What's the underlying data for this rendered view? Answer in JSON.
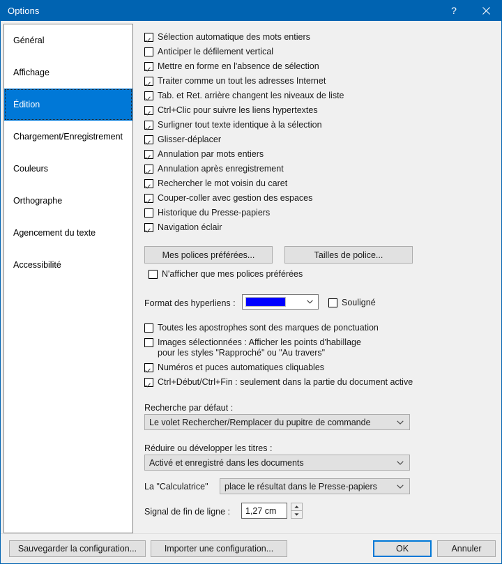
{
  "window": {
    "title": "Options",
    "help_icon": "question-mark-icon",
    "close_icon": "close-icon"
  },
  "sidebar": {
    "items": [
      {
        "label": "Général",
        "selected": false
      },
      {
        "label": "Affichage",
        "selected": false
      },
      {
        "label": "Édition",
        "selected": true
      },
      {
        "label": "Chargement/Enregistrement",
        "selected": false
      },
      {
        "label": "Couleurs",
        "selected": false
      },
      {
        "label": "Orthographe",
        "selected": false
      },
      {
        "label": "Agencement du texte",
        "selected": false
      },
      {
        "label": "Accessibilité",
        "selected": false
      }
    ],
    "selected_bg": "#0078d7"
  },
  "main": {
    "checkboxes_top": [
      {
        "label": "Sélection automatique des mots entiers",
        "checked": true
      },
      {
        "label": "Anticiper le défilement vertical",
        "checked": false
      },
      {
        "label": "Mettre en forme en l'absence de sélection",
        "checked": true
      },
      {
        "label": "Traiter comme un tout les adresses Internet",
        "checked": true
      },
      {
        "label": "Tab. et Ret. arrière changent les niveaux de liste",
        "checked": true
      },
      {
        "label": "Ctrl+Clic pour suivre les liens hypertextes",
        "checked": true
      },
      {
        "label": "Surligner tout texte identique à la sélection",
        "checked": true
      },
      {
        "label": "Glisser-déplacer",
        "checked": true
      },
      {
        "label": "Annulation par mots entiers",
        "checked": true
      },
      {
        "label": "Annulation après enregistrement",
        "checked": true
      },
      {
        "label": "Rechercher le mot voisin du caret",
        "checked": true
      },
      {
        "label": "Couper-coller avec gestion des espaces",
        "checked": true
      },
      {
        "label": "Historique du Presse-papiers",
        "checked": false
      },
      {
        "label": "Navigation éclair",
        "checked": true
      }
    ],
    "font_buttons": {
      "preferred_fonts": "Mes polices préférées...",
      "font_sizes": "Tailles de police..."
    },
    "only_preferred_fonts": {
      "label": "N'afficher que mes polices préférées",
      "checked": false
    },
    "hyperlink_format": {
      "label": "Format des hyperliens :",
      "color": "#0000FF",
      "underline_label": "Souligné",
      "underline_checked": false
    },
    "checkboxes_bottom": [
      {
        "label": "Toutes les apostrophes sont des marques de ponctuation",
        "checked": false
      },
      {
        "label": "Images sélectionnées : Afficher les points d'habillage\npour les styles \"Rapproché\" ou \"Au travers\"",
        "checked": false
      },
      {
        "label": "Numéros et puces automatiques cliquables",
        "checked": true
      },
      {
        "label": "Ctrl+Début/Ctrl+Fin : seulement dans la partie du document active",
        "checked": true
      }
    ],
    "default_search": {
      "label": "Recherche par défaut :",
      "value": "Le volet Rechercher/Remplacer du pupitre de commande"
    },
    "collapse_headings": {
      "label": "Réduire ou développer les titres :",
      "value": "Activé et enregistré dans les documents"
    },
    "calculator": {
      "label": "La \"Calculatrice\"",
      "value": "place le résultat dans le Presse-papiers"
    },
    "line_end_signal": {
      "label": "Signal de fin de ligne :",
      "value": "1,27 cm"
    }
  },
  "footer": {
    "save_config": "Sauvegarder la configuration...",
    "import_config": "Importer une configuration...",
    "ok": "OK",
    "cancel": "Annuler"
  }
}
